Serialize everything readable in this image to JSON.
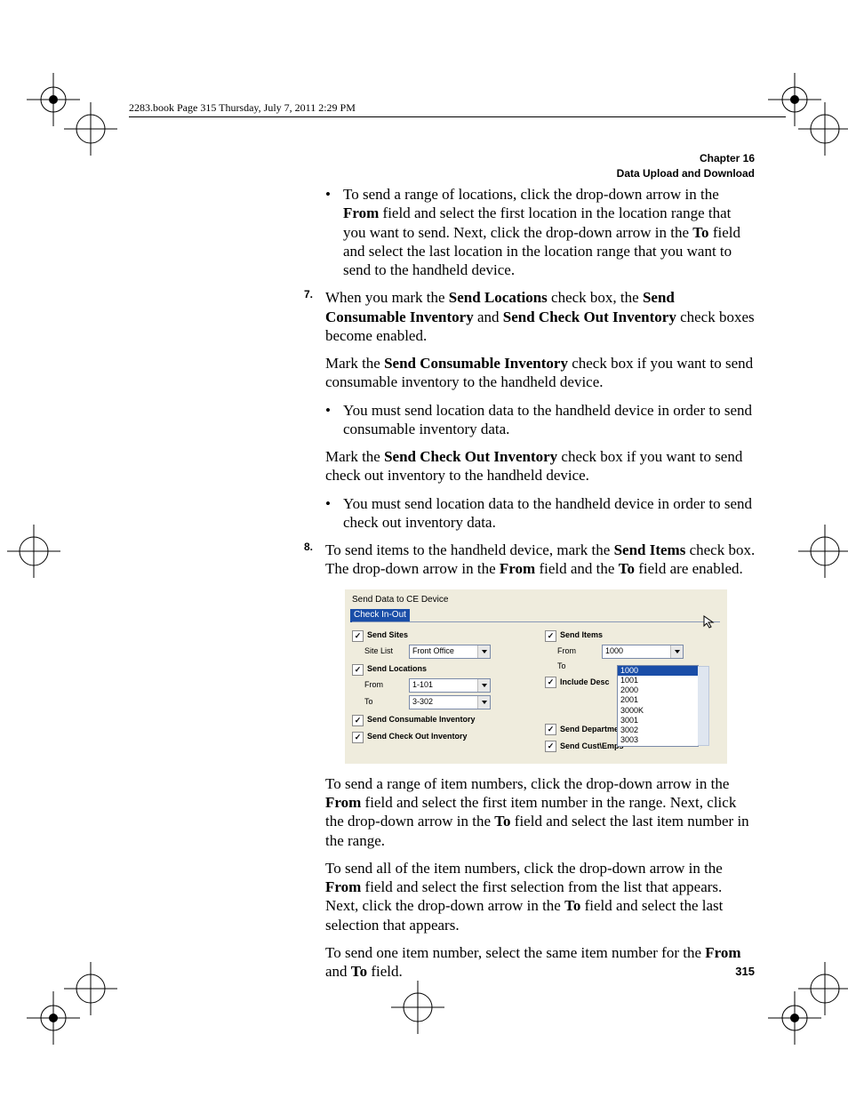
{
  "header_line": "2283.book  Page 315  Thursday, July 7, 2011  2:29 PM",
  "chapter": {
    "num": "Chapter 16",
    "title": "Data Upload and Download"
  },
  "page_number": "315",
  "bullets": {
    "b1a": "To send a range of locations, click the drop-down arrow in the ",
    "b1b": "From",
    "b1c": " field and select the first location in the location range that you want to send. Next, click the drop-down arrow in the ",
    "b1d": "To",
    "b1e": " field and select the last location in the location range that you want to send to the handheld device."
  },
  "step7": {
    "num": "7.",
    "p1a": "When you mark the ",
    "p1b": "Send Locations",
    "p1c": " check box, the ",
    "p1d": "Send Consumable Inventory",
    "p1e": " and ",
    "p1f": "Send Check Out Inventory",
    "p1g": " check boxes become enabled.",
    "p2a": "Mark the ",
    "p2b": "Send Consumable Inventory",
    "p2c": " check box if you want to send consumable inventory to the handheld device.",
    "sb1": "You must send location data to the handheld device in order to send consumable inventory data.",
    "p3a": "Mark the ",
    "p3b": "Send Check Out Inventory",
    "p3c": " check box if you want to send check out inventory to the handheld device.",
    "sb2": "You must send location data to the handheld device in order to send check out inventory data."
  },
  "step8": {
    "num": "8.",
    "p1a": "To send items to the handheld device, mark the ",
    "p1b": "Send Items",
    "p1c": " check box. The drop-down arrow in the ",
    "p1d": "From",
    "p1e": " field and the ",
    "p1f": "To",
    "p1g": " field are enabled."
  },
  "screenshot": {
    "title": "Send Data to CE Device",
    "tab": "Check In-Out",
    "left": {
      "cb_sites": "Send Sites",
      "site_list_label": "Site List",
      "site_list_value": "Front Office",
      "cb_locations": "Send Locations",
      "from_label": "From",
      "from_value": "1-101",
      "to_label": "To",
      "to_value": "3-302",
      "cb_consumable": "Send Consumable Inventory",
      "cb_checkout": "Send Check Out Inventory"
    },
    "right": {
      "cb_items": "Send Items",
      "from_label": "From",
      "from_value": "1000",
      "to_label": "To",
      "cb_include": "Include Desc",
      "list": [
        "1000",
        "1001",
        "2000",
        "2001",
        "3000K",
        "3001",
        "3002",
        "3003"
      ],
      "cb_departments": "Send Departments",
      "cb_custemps": "Send Cust\\Emps"
    }
  },
  "after": {
    "p1a": "To send a range of item numbers, click the drop-down arrow in the ",
    "p1b": "From",
    "p1c": " field and select the first item number in the range. Next, click the drop-down arrow in the ",
    "p1d": "To",
    "p1e": " field and select the last item number in the range.",
    "p2a": "To send all of the item numbers, click the drop-down arrow in the ",
    "p2b": "From",
    "p2c": " field and select the first selection from the list that appears. Next, click the drop-down arrow in the ",
    "p2d": "To",
    "p2e": " field and select the last selection that appears.",
    "p3a": "To send one item number, select the same item number for the ",
    "p3b": "From",
    "p3c": " and ",
    "p3d": "To",
    "p3e": " field."
  }
}
